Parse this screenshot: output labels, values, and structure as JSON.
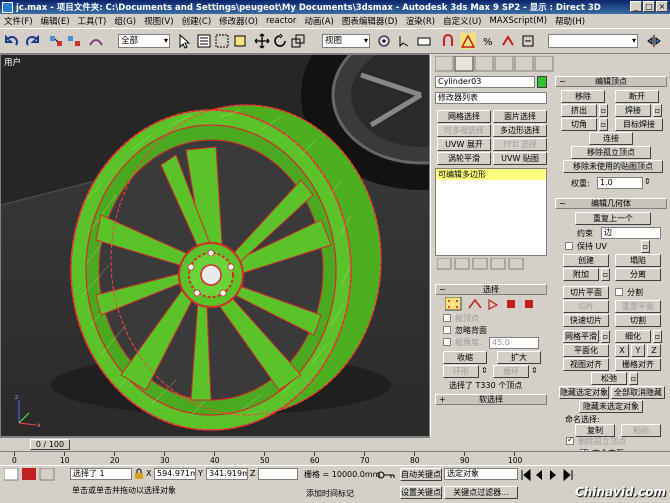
{
  "window": {
    "title": "jc.max  - 项目文件夹: C:\\Documents and Settings\\peugeot\\My Documents\\3dsmax    - Autodesk 3ds Max 9 SP2    - 显示 : Direct 3D"
  },
  "menu": [
    "文件(F)",
    "编辑(E)",
    "工具(T)",
    "组(G)",
    "视图(V)",
    "创建(C)",
    "修改器(O)",
    "reactor",
    "动画(A)",
    "图表编辑器(D)",
    "渲染(R)",
    "自定义(U)",
    "MAXScript(M)",
    "帮助(H)"
  ],
  "toolbar": {
    "selection_filter": "全部",
    "reference_coord": "视图"
  },
  "viewport": {
    "label": "用户"
  },
  "command_panel": {
    "object_name": "Cylinder03",
    "object_color": "#2fbf2f",
    "modifier_list_label": "修改器列表",
    "modifier_buttons": [
      "网格选择",
      "面片选择",
      "可多视选择",
      "多边形选择",
      "UVW 展开",
      "FFD 选择",
      "涡轮平滑",
      "UVW 贴图"
    ],
    "stack_item": "可编辑多边形",
    "selection": {
      "header": "选择",
      "by_vertex": "按顶点",
      "ignore_backfacing": "忽略背面",
      "by_angle": "按角度:",
      "angle_value": "45.0",
      "shrink": "收缩",
      "grow": "扩大",
      "ring": "环形",
      "loop": "循环",
      "status": "选择了 T330 个顶点"
    },
    "soft_selection": {
      "header": "软选择"
    },
    "edit_vertices": {
      "header": "编辑顶点",
      "remove": "移除",
      "break": "断开",
      "extrude": "挤出",
      "weld": "焊接",
      "chamfer": "切角",
      "target_weld": "目标焊接",
      "connect": "连接",
      "remove_isolated": "移除孤立顶点",
      "remove_unused_map": "移除未使用的贴图顶点",
      "weight_label": "权重:",
      "weight_value": "1.0"
    },
    "edit_geometry": {
      "header": "编辑几何体",
      "repeat_last": "重复上一个",
      "constraint_label": "约束",
      "constraint_value": "边",
      "preserve_uv": "保持 UV",
      "create": "创建",
      "collapse": "塌陷",
      "attach": "附加",
      "detach": "分离",
      "slice_plane": "切片平面",
      "split": "分割",
      "slice": "切片",
      "reset_plane": "重置平面",
      "quickslice": "快速切片",
      "cut": "切割",
      "meshsmooth": "网格平滑",
      "tessellate": "细化",
      "make_planar": "平面化",
      "x": "X",
      "y": "Y",
      "z": "Z",
      "view_align": "视图对齐",
      "grid_align": "栅格对齐",
      "relax": "松弛",
      "hide_selected": "隐藏选定对象",
      "unhide_all": "全部取消隐藏",
      "hide_unselected": "隐藏未选定对象",
      "named_selections": "命名选择:",
      "copy": "复制",
      "paste": "粘贴",
      "delete_isolated": "删除孤立顶点",
      "full_interactivity": "完全交互"
    }
  },
  "timeline": {
    "slider": "0 / 100",
    "ticks": [
      "0",
      "10",
      "20",
      "30",
      "40",
      "50",
      "60",
      "70",
      "80",
      "90",
      "100"
    ]
  },
  "status": {
    "selected": "选择了 1",
    "x_value": "594.971mm",
    "y_value": "341.919mm",
    "z_label": "Z",
    "grid": "栅格 = 10000.0mm",
    "auto_key": "自动关键点",
    "set_key": "设置关键点",
    "key_mode_value": "选定对象",
    "key_filters": "关键点过滤器...",
    "prompt": "单击或单击并拖动以选择对象",
    "add_time_tag": "添加时间标记"
  },
  "watermark": "Chinavid.com"
}
